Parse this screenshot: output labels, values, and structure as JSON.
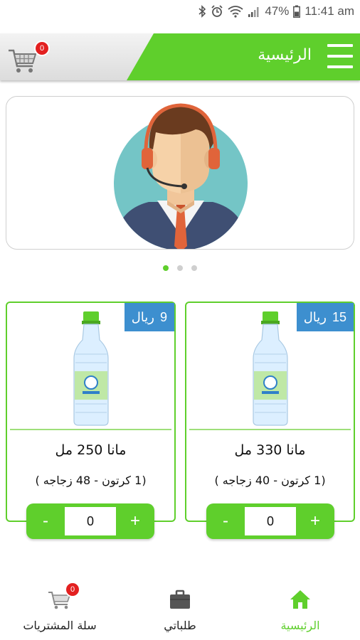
{
  "status_bar": {
    "battery": "47%",
    "time": "11:41 am"
  },
  "header": {
    "title": "الرئيسية",
    "cart_count": "0"
  },
  "banner": {
    "slides": 3,
    "active_slide": 1
  },
  "products": [
    {
      "price_value": "15",
      "price_currency": "ريال",
      "name": "مانا 330 مل",
      "description": "(1 كرتون  -  40  زجاجه )",
      "quantity": "0",
      "minus_label": "-",
      "plus_label": "+"
    },
    {
      "price_value": "9",
      "price_currency": "ريال",
      "name": "مانا 250 مل",
      "description": "(1 كرتون  -  48 زجاجه )",
      "quantity": "0",
      "minus_label": "-",
      "plus_label": "+"
    }
  ],
  "bottom_nav": {
    "items": [
      {
        "label": "الرئيسية",
        "icon": "home-icon",
        "active": true
      },
      {
        "label": "طلباتي",
        "icon": "briefcase-icon",
        "active": false
      },
      {
        "label": "سلة المشتريات",
        "icon": "cart-icon",
        "active": false
      }
    ],
    "cart_badge": "0"
  },
  "colors": {
    "accent_green": "#5fcf2c",
    "price_blue": "#3d8fcf",
    "badge_red": "#e32020"
  }
}
